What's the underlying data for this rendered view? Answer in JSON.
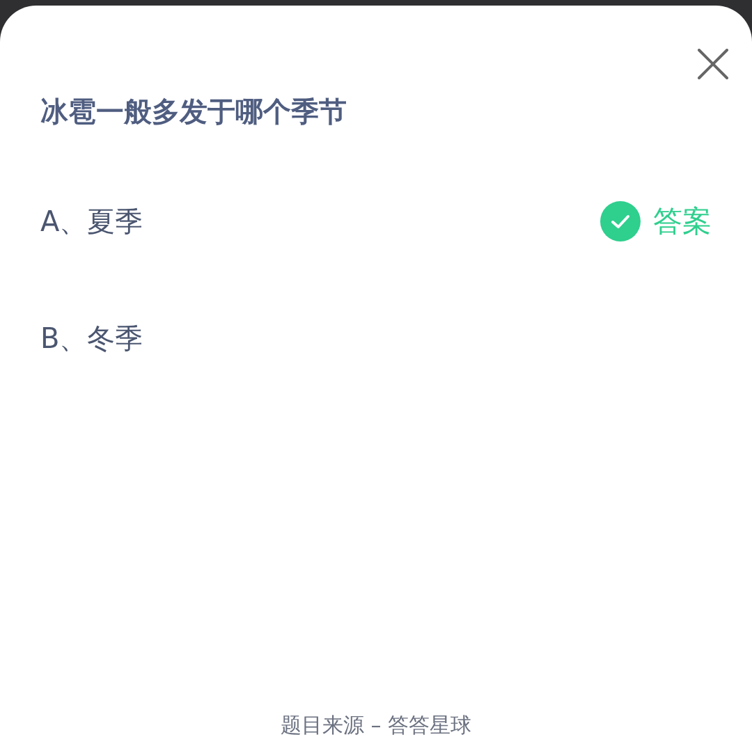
{
  "question": {
    "title": "冰雹一般多发于哪个季节"
  },
  "answer_label": "答案",
  "options": [
    {
      "label": "A、夏季",
      "correct": true
    },
    {
      "label": "B、冬季",
      "correct": false
    }
  ],
  "footer": "题目来源 – 答答星球"
}
